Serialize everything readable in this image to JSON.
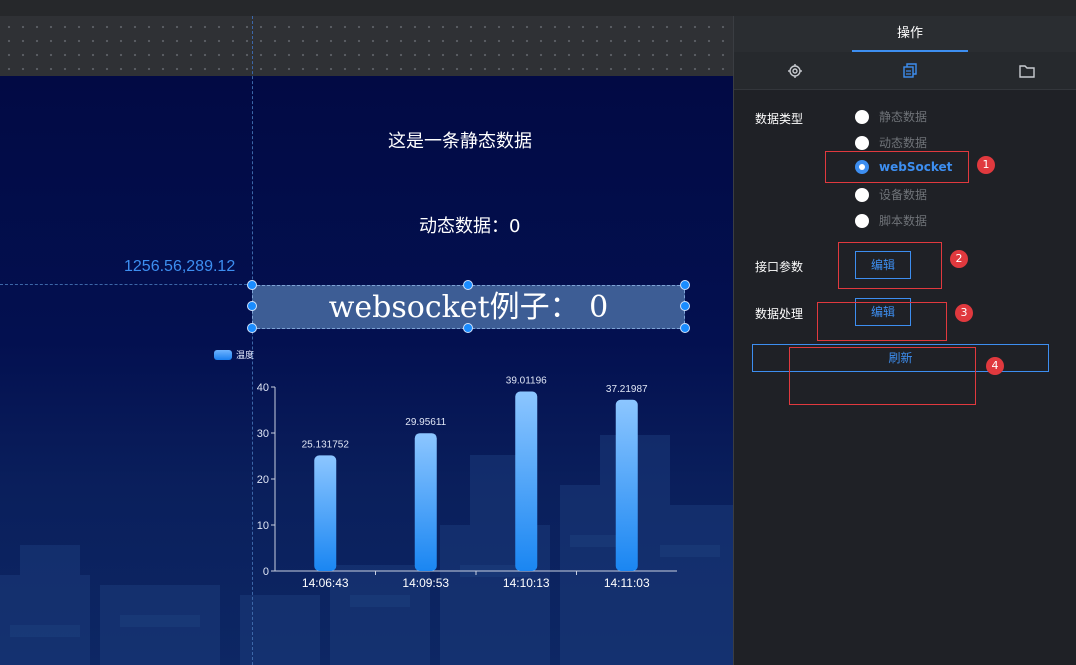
{
  "canvas": {
    "static_text": "这是一条静态数据",
    "dynamic_text": "动态数据：0",
    "coord_readout": "1256.56,289.12",
    "websocket_text": "websocket例子：  0"
  },
  "chart_data": {
    "type": "bar",
    "categories": [
      "14:06:43",
      "14:09:53",
      "14:10:13",
      "14:11:03"
    ],
    "series": [
      {
        "name": "温度",
        "values": [
          25.131752,
          29.95611,
          39.01196,
          37.21987
        ]
      }
    ],
    "data_labels": [
      "25.131752",
      "29.95611",
      "39.01196",
      "37.21987"
    ],
    "yticks": [
      "0",
      "10",
      "20",
      "30",
      "40"
    ],
    "ylim": [
      0,
      40
    ],
    "legend": "温度",
    "legend_position": "top-left",
    "bar_color": "#3a9cff"
  },
  "panel": {
    "title": "操作",
    "tabs": [
      {
        "icon": "gear-icon"
      },
      {
        "icon": "copy-icon"
      },
      {
        "icon": "folder-icon"
      }
    ],
    "data_type_label": "数据类型",
    "data_type_options": [
      {
        "label": "静态数据",
        "checked": false
      },
      {
        "label": "动态数据",
        "checked": false
      },
      {
        "label": "webSocket",
        "checked": true
      },
      {
        "label": "设备数据",
        "checked": false
      },
      {
        "label": "脚本数据",
        "checked": false
      }
    ],
    "interface_params_label": "接口参数",
    "interface_edit_label": "编辑",
    "data_processing_label": "数据处理",
    "processing_edit_label": "编辑",
    "refresh_label": "刷新",
    "annotations": [
      "1",
      "2",
      "3",
      "4"
    ],
    "accent_color": "#3d8ef0",
    "annotation_color": "#e0393e"
  }
}
